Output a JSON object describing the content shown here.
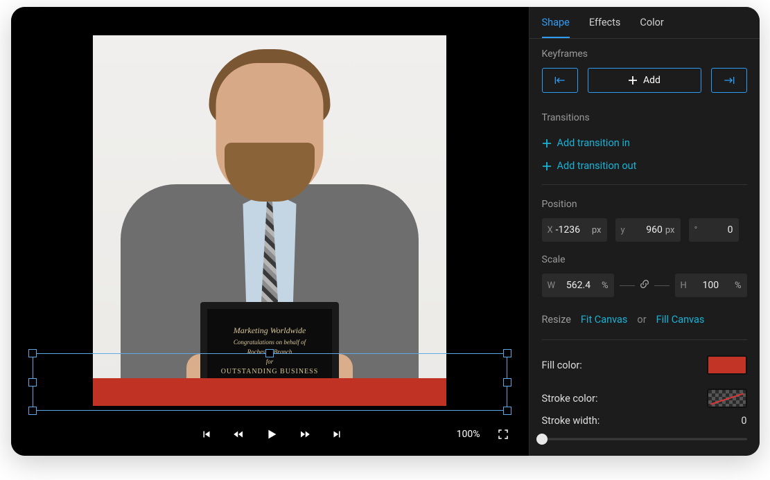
{
  "tabs": {
    "shape": "Shape",
    "effects": "Effects",
    "color": "Color"
  },
  "keyframes": {
    "label": "Keyframes",
    "addLabel": "Add"
  },
  "transitions": {
    "label": "Transitions",
    "inLabel": "Add transition in",
    "outLabel": "Add transition out"
  },
  "position": {
    "label": "Position",
    "xPrefix": "X",
    "xValue": "-1236",
    "xUnit": "px",
    "yPrefix": "y",
    "yValue": "960",
    "yUnit": "px",
    "degPrefix": "°",
    "degValue": "0"
  },
  "scale": {
    "label": "Scale",
    "wPrefix": "W",
    "wValue": "562.4",
    "wUnit": "%",
    "hPrefix": "H",
    "hValue": "100",
    "hUnit": "%"
  },
  "resize": {
    "label": "Resize",
    "fit": "Fit Canvas",
    "or": "or",
    "fill": "Fill Canvas"
  },
  "fill": {
    "label": "Fill color:",
    "color": "#c13426"
  },
  "stroke": {
    "label": "Stroke color:"
  },
  "strokeWidth": {
    "label": "Stroke width:",
    "value": "0"
  },
  "playback": {
    "zoom": "100%"
  },
  "plaque": {
    "title": "Marketing Worldwide",
    "line1": "Congratulations on behalf of",
    "line2": "Rochester Branch",
    "line3": "for",
    "line4": "OUTSTANDING BUSINESS"
  }
}
